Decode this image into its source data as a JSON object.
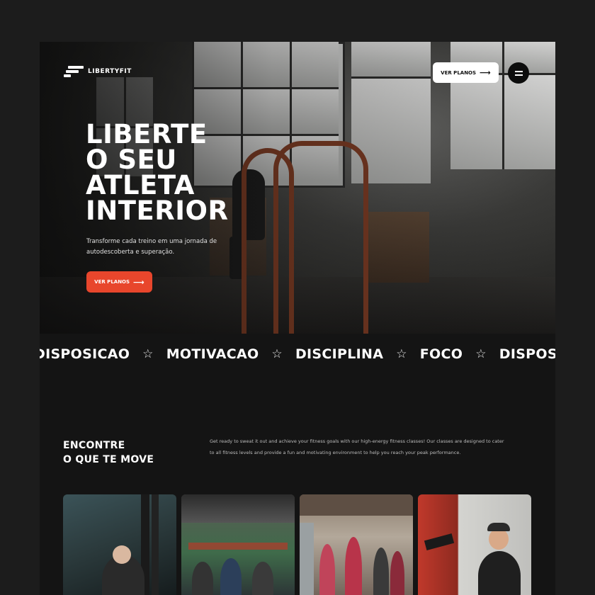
{
  "brand": {
    "name": "LIBERTYFIT"
  },
  "header": {
    "cta_label": "VER PLANOS",
    "menu_icon": "menu-icon"
  },
  "hero": {
    "title_lines": [
      "LIBERTE",
      "O SEU",
      "ATLETA",
      "INTERIOR"
    ],
    "subtitle": "Transforme cada treino em uma jornada de autodescoberta e superação.",
    "cta_label": "VER PLANOS",
    "cta_color": "#e8462c"
  },
  "marquee": {
    "items": [
      "DISPOSICAO",
      "MOTIVACAO",
      "DISCIPLINA",
      "FOCO",
      "DISPOSIÇÃO"
    ],
    "separator_icon": "star-icon"
  },
  "about": {
    "heading_lines": [
      "ENCONTRE",
      "O QUE TE MOVE"
    ],
    "text": "Get ready to sweat it out and achieve your fitness goals with our high-energy fitness classes! Our classes are designed to cater to all fitness levels and provide a fun and motivating environment to help you reach your peak performance."
  },
  "classes": {
    "cards": [
      {
        "name": "class-card-1"
      },
      {
        "name": "class-card-2"
      },
      {
        "name": "class-card-3"
      },
      {
        "name": "class-card-4"
      }
    ]
  }
}
